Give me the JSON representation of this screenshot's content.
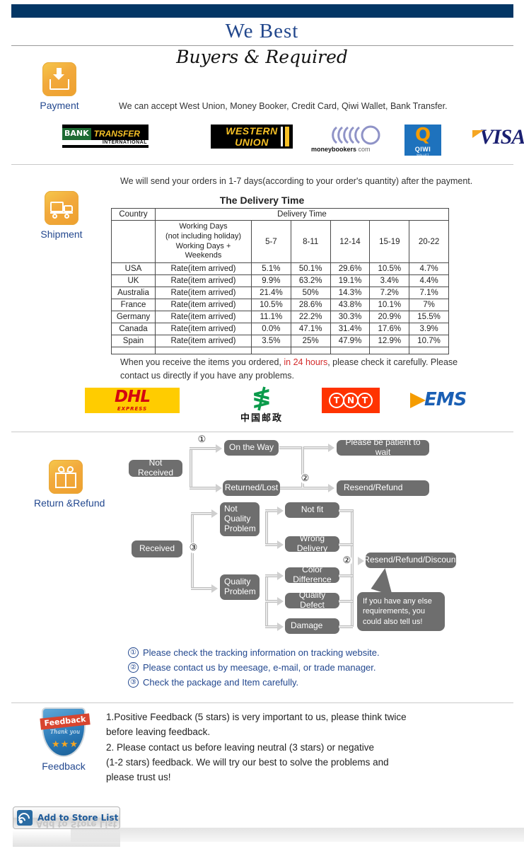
{
  "header": {
    "title": "We   Best",
    "subtitle": "Buyers & Required"
  },
  "payment": {
    "icon_label": "Payment",
    "description": "We can accept West Union, Money Booker, Credit Card, Qiwi Wallet, Bank Transfer.",
    "logos": [
      {
        "name": "bank-transfer",
        "line1": "BANK",
        "line2": "TRANSFER",
        "sub": "INTERNATIONAL"
      },
      {
        "name": "western-union",
        "line1": "WESTERN",
        "line2": "UNION"
      },
      {
        "name": "moneybookers",
        "text": "moneybookers",
        "suffix": " com"
      },
      {
        "name": "qiwi",
        "mark": "Q",
        "text": "QIWI",
        "sub": "WALLET"
      },
      {
        "name": "visa",
        "text": "VISA"
      }
    ]
  },
  "shipment": {
    "icon_label": "Shipment",
    "intro": "We will send your orders in 1-7 days(according to your order's quantity) after the payment.",
    "table_title": "The Delivery Time",
    "table": {
      "col_country": "Country",
      "col_delivery": "Delivery Time",
      "working_days_header": [
        "Working Days",
        "(not including holiday)",
        "Working Days + Weekends"
      ],
      "day_ranges": [
        "5-7",
        "8-11",
        "12-14",
        "15-19",
        "20-22"
      ],
      "rate_label": "Rate(item arrived)",
      "rows": [
        {
          "country": "USA",
          "rates": [
            "5.1%",
            "50.1%",
            "29.6%",
            "10.5%",
            "4.7%"
          ]
        },
        {
          "country": "UK",
          "rates": [
            "9.9%",
            "63.2%",
            "19.1%",
            "3.4%",
            "4.4%"
          ]
        },
        {
          "country": "Australia",
          "rates": [
            "21.4%",
            "50%",
            "14.3%",
            "7.2%",
            "7.1%"
          ]
        },
        {
          "country": "France",
          "rates": [
            "10.5%",
            "28.6%",
            "43.8%",
            "10.1%",
            "7%"
          ]
        },
        {
          "country": "Germany",
          "rates": [
            "11.1%",
            "22.2%",
            "30.3%",
            "20.9%",
            "15.5%"
          ]
        },
        {
          "country": "Canada",
          "rates": [
            "0.0%",
            "47.1%",
            "31.4%",
            "17.6%",
            "3.9%"
          ]
        },
        {
          "country": "Spain",
          "rates": [
            "3.5%",
            "25%",
            "47.9%",
            "12.9%",
            "10.7%"
          ]
        }
      ]
    },
    "check_note_pre": "When you receive the items you ordered, ",
    "check_note_highlight": "in 24 hours",
    "check_note_post": ", please check it carefully. Please",
    "check_note_line2": "contact us directly if you have any problems.",
    "carriers": [
      {
        "name": "dhl",
        "text": "DHL",
        "sub": "EXPRESS"
      },
      {
        "name": "china-post",
        "text": "中国邮政"
      },
      {
        "name": "tnt",
        "letters": [
          "T",
          "N",
          "T"
        ]
      },
      {
        "name": "ems",
        "text": "EMS"
      }
    ]
  },
  "returns": {
    "icon_label": "Return &Refund",
    "nodes": {
      "not_received": "Not Received",
      "on_the_way": "On the Way",
      "returned_lost": "Returned/Lost",
      "please_wait": "Please be patient to wait",
      "resend_refund": "Resend/Refund",
      "received": "Received",
      "not_quality_problem": "Not\nQuality\nProblem",
      "quality_problem": "Quality\nProblem",
      "not_fit": "Not fit",
      "wrong_delivery": "Wrong Delivery",
      "color_difference": "Color Difference",
      "quality_defect": "Quality Defect",
      "damage": "Damage",
      "resend_refund_discount": "Resend/Refund/Discount"
    },
    "bubble": "If you have any else requirements, you could also tell us!",
    "markers": {
      "m1": "①",
      "m2a": "②",
      "m2b": "②",
      "m3": "③"
    },
    "notes": [
      {
        "num": "①",
        "text": "Please check the tracking information on tracking website."
      },
      {
        "num": "②",
        "text": "Please contact us by meesage, e-mail, or trade manager."
      },
      {
        "num": "③",
        "text": "Check the package and Item carefully."
      }
    ]
  },
  "feedback": {
    "icon_label": "Feedback",
    "badge_title": "Feedback",
    "badge_sub": "Thank you",
    "badge_stars": "★★★",
    "lines": [
      "1.Positive Feedback (5 stars) is very important to us, please think twice",
      " before leaving feedback.",
      "2. Please contact us before leaving neutral (3 stars) or negative",
      "(1-2 stars) feedback. We will try our best to solve the problems and",
      " please trust us!"
    ]
  },
  "store_button": {
    "label": "Add to Store List",
    "icon": "rss-icon"
  },
  "colors": {
    "banner": "#033665",
    "title_blue": "#22478c",
    "label_blue": "#23488f",
    "node_gray": "#6e6e6e",
    "highlight_red": "#d42b2b"
  }
}
